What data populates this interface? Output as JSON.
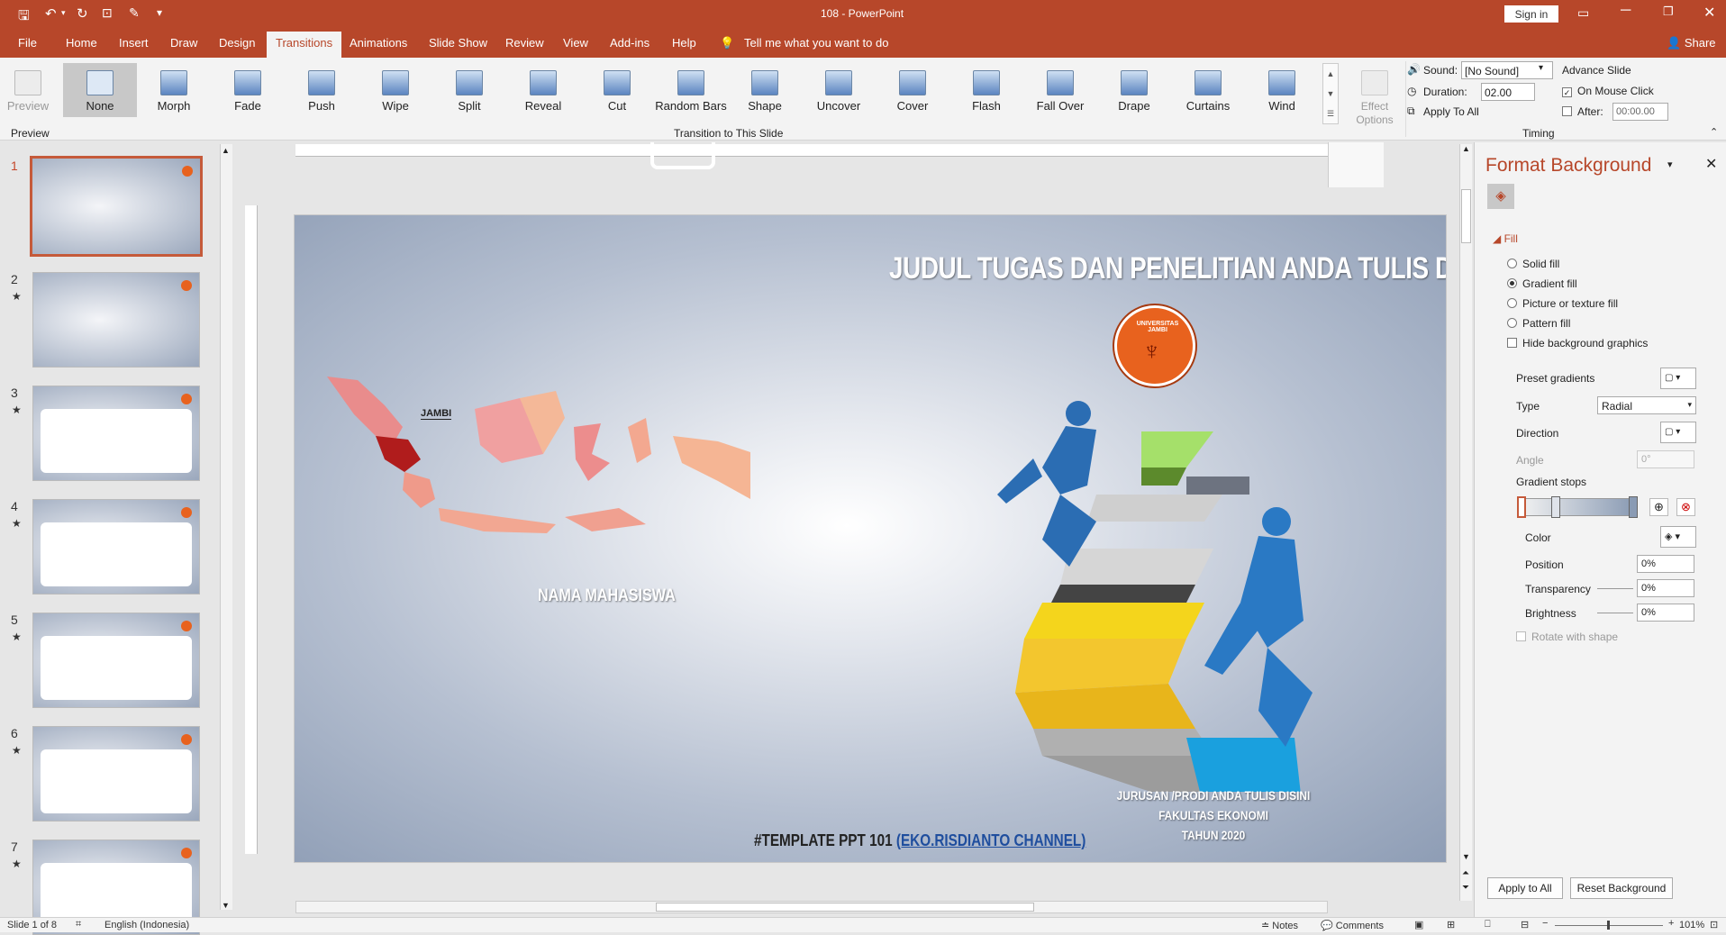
{
  "window": {
    "title": "108  -  PowerPoint",
    "sign_in": "Sign in",
    "share": "Share"
  },
  "qat": {
    "customize": "▾"
  },
  "tabs": [
    {
      "label": "File"
    },
    {
      "label": "Home"
    },
    {
      "label": "Insert"
    },
    {
      "label": "Draw"
    },
    {
      "label": "Design"
    },
    {
      "label": "Transitions"
    },
    {
      "label": "Animations"
    },
    {
      "label": "Slide Show"
    },
    {
      "label": "Review"
    },
    {
      "label": "View"
    },
    {
      "label": "Add-ins"
    },
    {
      "label": "Help"
    }
  ],
  "tell_me": "Tell me what you want to do",
  "ribbon": {
    "preview": "Preview",
    "transitions": [
      "None",
      "Morph",
      "Fade",
      "Push",
      "Wipe",
      "Split",
      "Reveal",
      "Cut",
      "Random Bars",
      "Shape",
      "Uncover",
      "Cover",
      "Flash",
      "Fall Over",
      "Drape",
      "Curtains",
      "Wind"
    ],
    "effect_options": "Effect Options",
    "group_preview": "Preview",
    "group_transition": "Transition to This Slide",
    "group_timing": "Timing",
    "timing": {
      "sound_label": "Sound:",
      "sound_value": "[No Sound]",
      "duration_label": "Duration:",
      "duration_value": "02.00",
      "apply_all": "Apply To All",
      "advance_slide": "Advance Slide",
      "on_mouse_click": "On Mouse Click",
      "after_label": "After:",
      "after_value": "00:00.00"
    }
  },
  "slides": [
    {
      "num": "1",
      "star": ""
    },
    {
      "num": "2",
      "star": "★"
    },
    {
      "num": "3",
      "star": "★"
    },
    {
      "num": "4",
      "star": "★"
    },
    {
      "num": "5",
      "star": "★"
    },
    {
      "num": "6",
      "star": "★"
    },
    {
      "num": "7",
      "star": "★"
    }
  ],
  "slide_content": {
    "title": "JUDUL TUGAS DAN PENELITIAN ANDA TULIS DISINI",
    "region_label": "JAMBI",
    "student": "NAMA MAHASISWA",
    "line1": "JURUSAN /PRODI ANDA TULIS DISINI",
    "line2": "FAKULTAS EKONOMI",
    "line3": "TAHUN 2020",
    "template_text": "#TEMPLATE PPT 101 ",
    "channel": "(EKO.RISDIANTO CHANNEL)",
    "logo_text": "UNIVERSITAS JAMBI"
  },
  "format_panel": {
    "title": "Format Background",
    "fill_header": "Fill",
    "fill_options": [
      "Solid fill",
      "Gradient fill",
      "Picture or texture fill",
      "Pattern fill"
    ],
    "selected_fill": 1,
    "hide_bg": "Hide background graphics",
    "preset_gradients": "Preset gradients",
    "type_label": "Type",
    "type_value": "Radial",
    "direction_label": "Direction",
    "angle_label": "Angle",
    "angle_value": "0°",
    "gradient_stops": "Gradient stops",
    "color_label": "Color",
    "position_label": "Position",
    "position_value": "0%",
    "transparency_label": "Transparency",
    "transparency_value": "0%",
    "brightness_label": "Brightness",
    "brightness_value": "0%",
    "rotate_with_shape": "Rotate with shape",
    "apply_all": "Apply to All",
    "reset": "Reset Background"
  },
  "status": {
    "slide": "Slide 1 of 8",
    "language": "English (Indonesia)",
    "notes": "Notes",
    "comments": "Comments",
    "zoom": "101%"
  },
  "colors": {
    "accent": "#b7472a",
    "slide_title": "#ffffff",
    "link": "#1f4e9e"
  }
}
